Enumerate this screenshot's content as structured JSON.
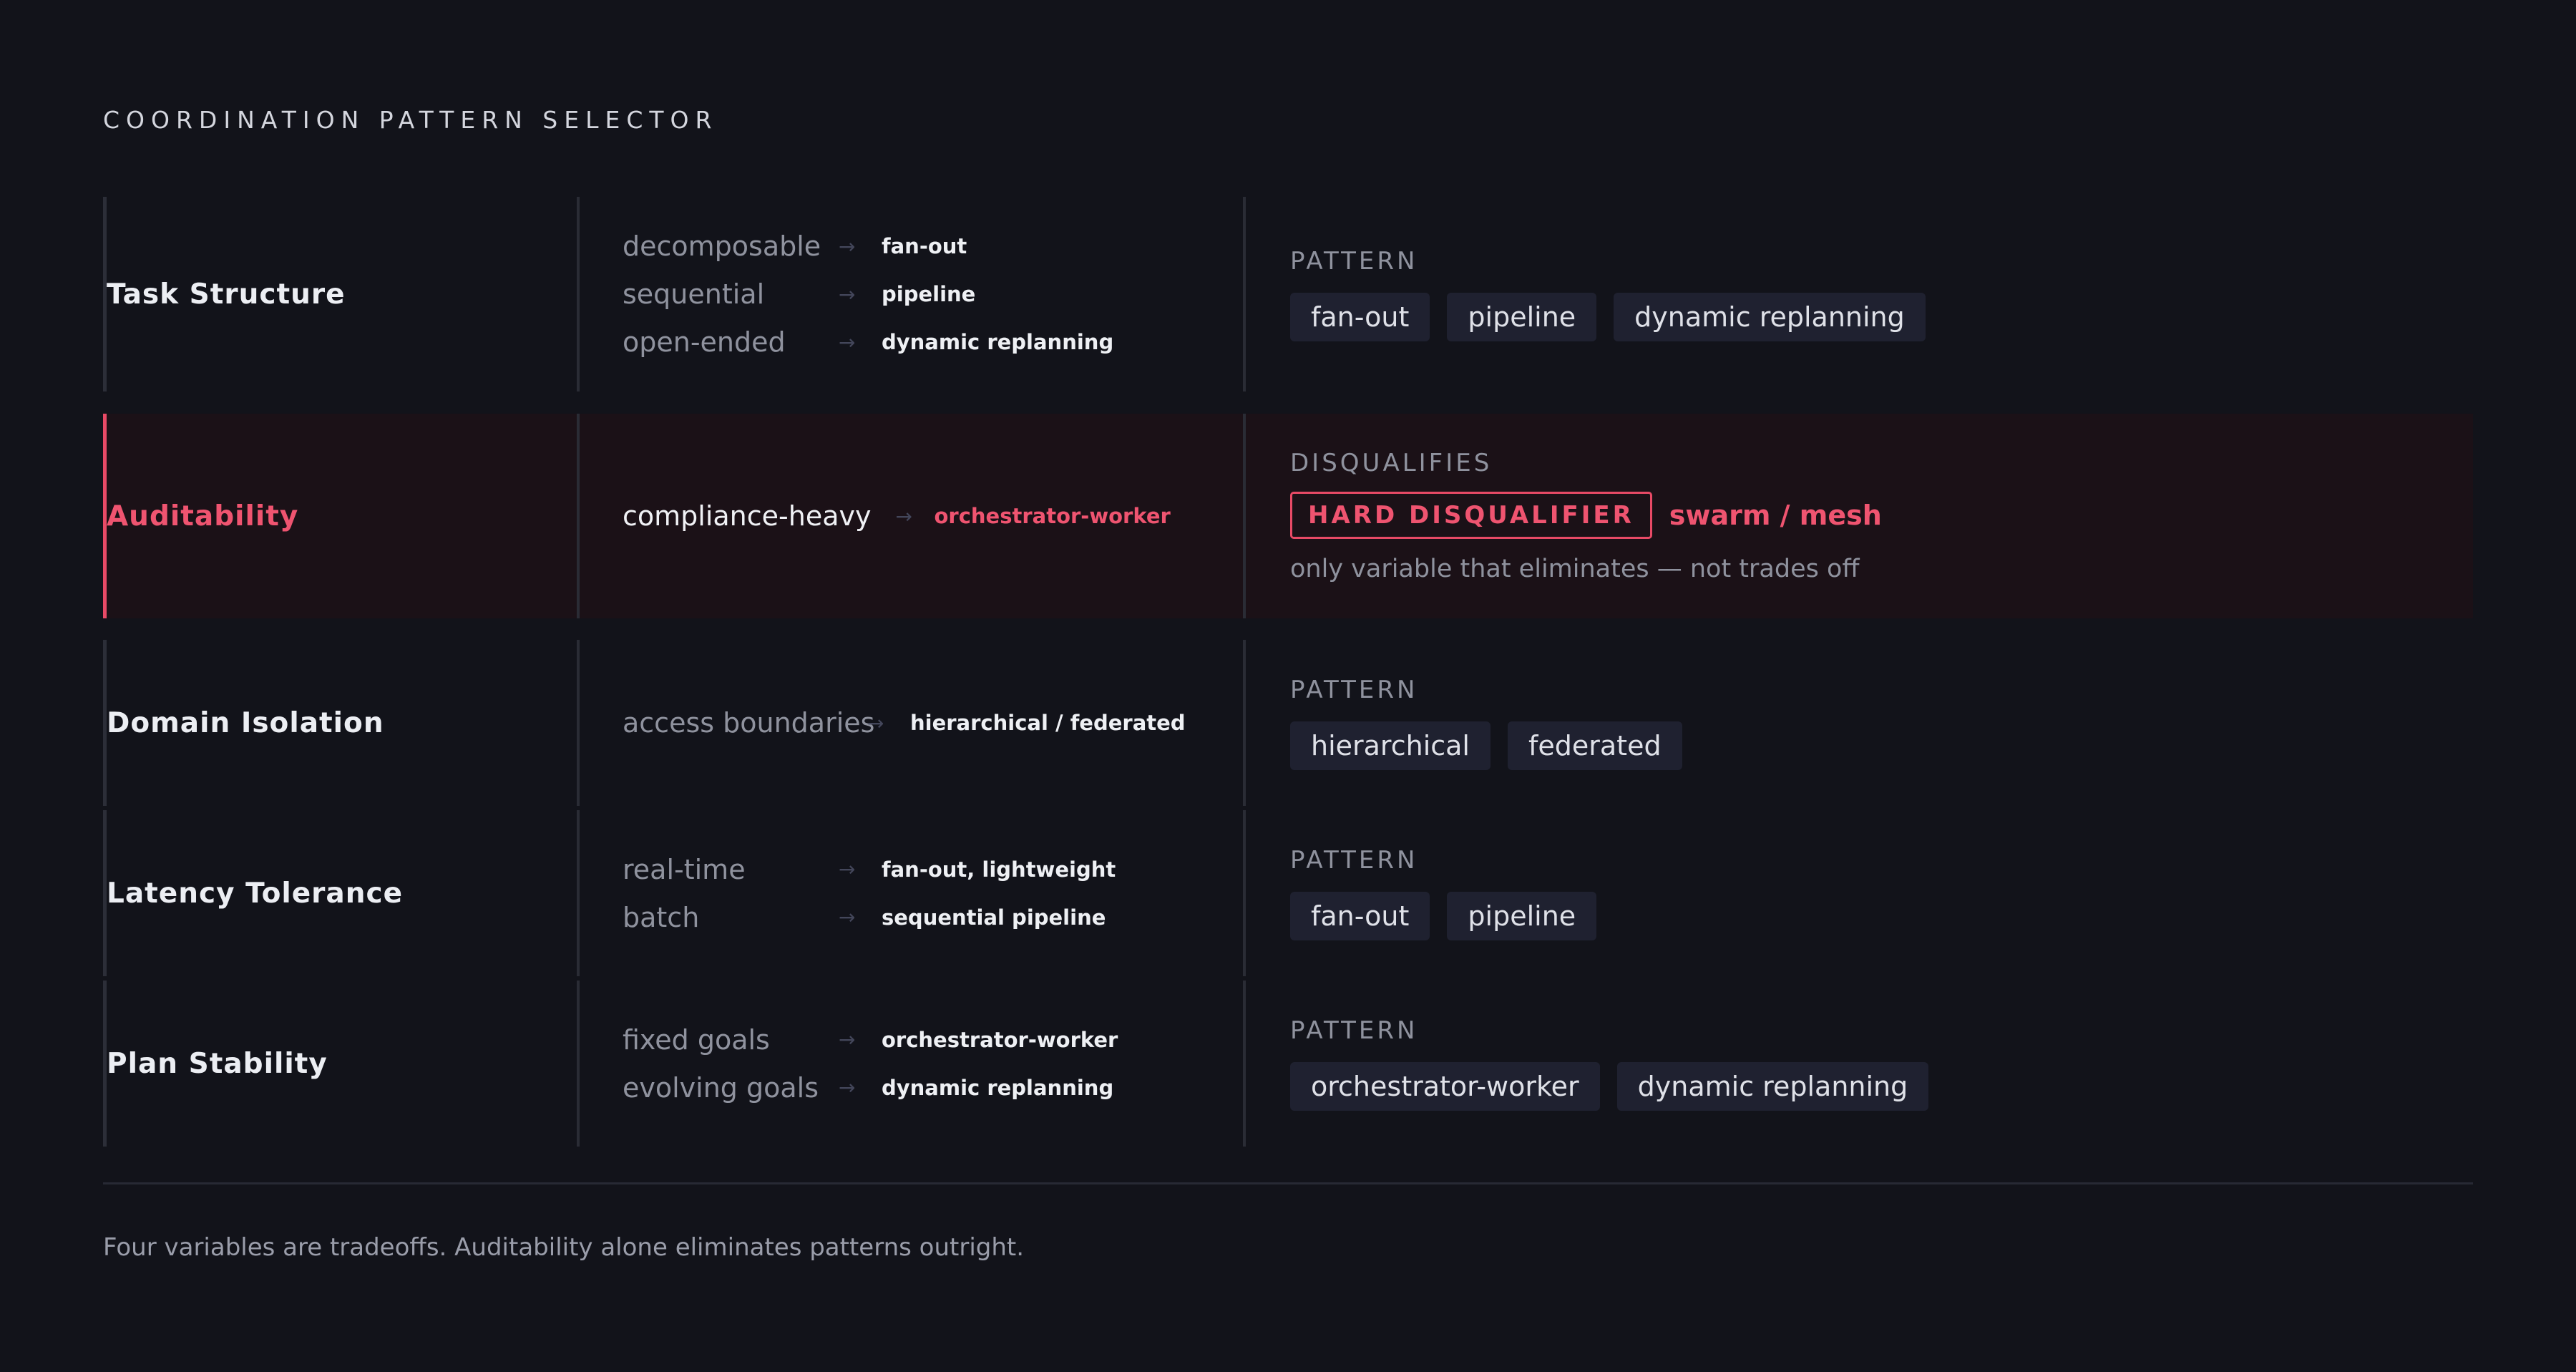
{
  "title": "COORDINATION PATTERN SELECTOR",
  "arrow": "→",
  "rows": [
    {
      "label": "Task Structure",
      "conditions": [
        {
          "cond": "decomposable",
          "result": "fan-out"
        },
        {
          "cond": "sequential",
          "result": "pipeline"
        },
        {
          "cond": "open-ended",
          "result": "dynamic replanning"
        }
      ],
      "right_heading": "PATTERN",
      "chips": [
        "fan-out",
        "pipeline",
        "dynamic replanning"
      ]
    },
    {
      "label": "Auditability",
      "conditions": [
        {
          "cond": "compliance-heavy",
          "result": "orchestrator-worker"
        }
      ],
      "right_heading": "DISQUALIFIES",
      "badge": "HARD DISQUALIFIER",
      "disqualified": "swarm / mesh",
      "note": "only variable that eliminates — not trades off"
    },
    {
      "label": "Domain Isolation",
      "conditions": [
        {
          "cond": "access boundaries",
          "result": "hierarchical / federated"
        }
      ],
      "right_heading": "PATTERN",
      "chips": [
        "hierarchical",
        "federated"
      ]
    },
    {
      "label": "Latency Tolerance",
      "conditions": [
        {
          "cond": "real-time",
          "result": "fan-out, lightweight"
        },
        {
          "cond": "batch",
          "result": "sequential pipeline"
        }
      ],
      "right_heading": "PATTERN",
      "chips": [
        "fan-out",
        "pipeline"
      ]
    },
    {
      "label": "Plan Stability",
      "conditions": [
        {
          "cond": "fixed goals",
          "result": "orchestrator-worker"
        },
        {
          "cond": "evolving goals",
          "result": "dynamic replanning"
        }
      ],
      "right_heading": "PATTERN",
      "chips": [
        "orchestrator-worker",
        "dynamic replanning"
      ]
    }
  ],
  "footer": "Four variables are tradeoffs. Auditability alone eliminates patterns outright.",
  "colors": {
    "accent": "#e84a66",
    "background": "#12131a",
    "highlight_row": "#1b1117",
    "chip": "#1f2130"
  }
}
